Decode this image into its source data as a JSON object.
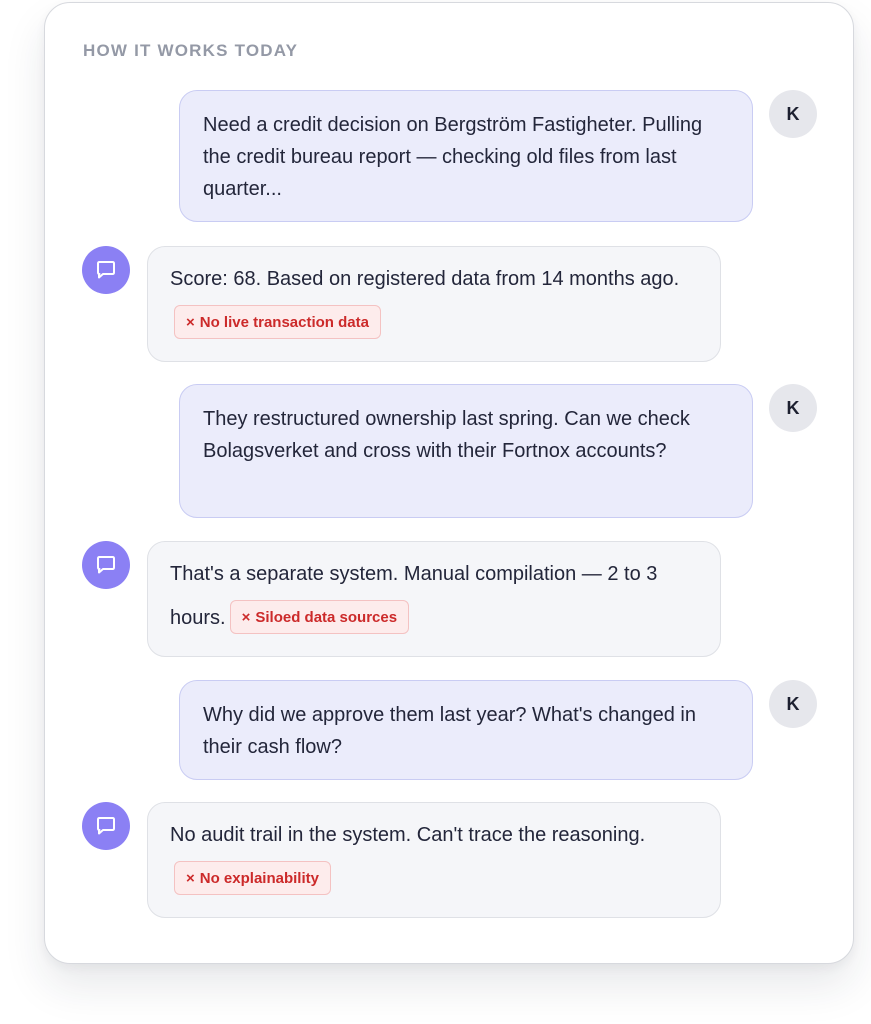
{
  "section": {
    "label": "HOW IT WORKS TODAY"
  },
  "messages": [
    {
      "role": "user",
      "avatar": "K",
      "text": "Need a credit decision on Bergström Fastigheter. Pulling the credit bureau report — checking old files from last quarter..."
    },
    {
      "role": "bot",
      "avatar_icon": "chat-bubble-icon",
      "text": "Score: 68. Based on registered data from 14 months ago.",
      "tag": {
        "mark": "×",
        "label": "No live transaction data"
      }
    },
    {
      "role": "user",
      "avatar": "K",
      "text": "They restructured ownership last spring. Can we check Bolagsverket and cross with their Fortnox accounts?"
    },
    {
      "role": "bot",
      "avatar_icon": "chat-bubble-icon",
      "text": "That's a separate system. Manual compilation — 2 to 3 hours.",
      "tag": {
        "mark": "×",
        "label": "Siloed data sources"
      }
    },
    {
      "role": "user",
      "avatar": "K",
      "text": "Why did we approve them last year? What's changed in their cash flow?"
    },
    {
      "role": "bot",
      "avatar_icon": "chat-bubble-icon",
      "text": "No audit trail in the system. Can't trace the reasoning.",
      "tag": {
        "mark": "×",
        "label": "No explainability"
      }
    }
  ],
  "colors": {
    "user_bubble": "#ebecfb",
    "bot_bubble": "#f5f6f9",
    "bot_avatar": "#8b80f4",
    "tag_text": "#cc2a2a",
    "tag_bg": "#fdecec"
  }
}
